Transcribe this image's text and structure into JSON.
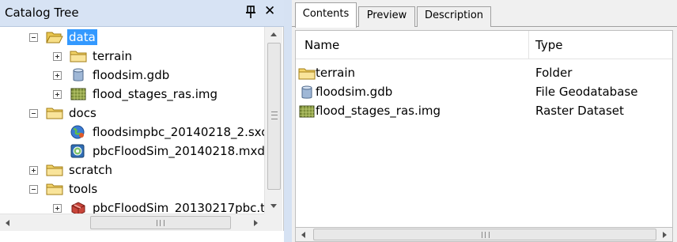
{
  "catalog": {
    "title": "Catalog Tree",
    "close_glyph": "✕",
    "tree": [
      {
        "label": "data",
        "icon": "open-folder-icon",
        "selected": true,
        "expander": "minus"
      },
      {
        "label": "terrain",
        "icon": "folder-icon",
        "expander": "plus"
      },
      {
        "label": "floodsim.gdb",
        "icon": "geodatabase-icon",
        "expander": "plus"
      },
      {
        "label": "flood_stages_ras.img",
        "icon": "raster-icon",
        "expander": "plus"
      },
      {
        "label": "docs",
        "icon": "folder-icon",
        "expander": "minus"
      },
      {
        "label": "floodsimpbc_20140218_2.sxc",
        "icon": "globe-document-icon",
        "expander": "none"
      },
      {
        "label": "pbcFloodSim_20140218.mxd",
        "icon": "map-document-icon",
        "expander": "none"
      },
      {
        "label": "scratch",
        "icon": "folder-icon",
        "expander": "plus"
      },
      {
        "label": "tools",
        "icon": "folder-icon",
        "expander": "minus"
      },
      {
        "label": "pbcFloodSim_20130217pbc.t",
        "icon": "toolbox-icon",
        "expander": "plus"
      }
    ]
  },
  "tabs": [
    {
      "label": "Contents",
      "active": true
    },
    {
      "label": "Preview",
      "active": false
    },
    {
      "label": "Description",
      "active": false
    }
  ],
  "contents": {
    "columns": {
      "name": "Name",
      "type": "Type"
    },
    "rows": [
      {
        "name": "terrain",
        "type": "Folder",
        "icon": "folder-icon"
      },
      {
        "name": "floodsim.gdb",
        "type": "File Geodatabase",
        "icon": "geodatabase-icon"
      },
      {
        "name": "flood_stages_ras.img",
        "type": "Raster Dataset",
        "icon": "raster-icon"
      }
    ]
  },
  "colors": {
    "title_bar": "#d7e3f4",
    "selection": "#3399ff",
    "folder": "#f3d46a"
  }
}
